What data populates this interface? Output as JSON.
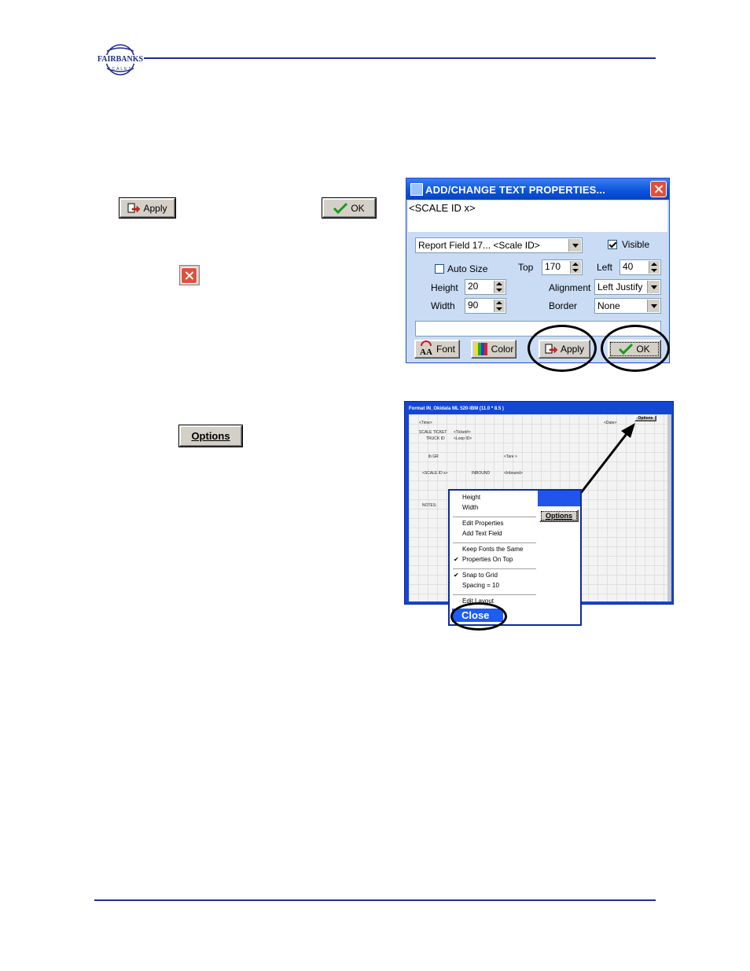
{
  "header": {
    "logo_text": "FAIRBANKS",
    "logo_sub": "SCALES"
  },
  "standalone": {
    "apply_label": "Apply",
    "ok_label": "OK",
    "options_label": "Options"
  },
  "dialog": {
    "title": "ADD/CHANGE TEXT PROPERTIES...",
    "text_value": "<SCALE ID  x>",
    "field_select": "Report Field 17... <Scale ID>",
    "visible_label": "Visible",
    "visible_checked": true,
    "auto_size_label": "Auto Size",
    "auto_size_checked": false,
    "top_label": "Top",
    "top_value": "170",
    "left_label": "Left",
    "left_value": "40",
    "height_label": "Height",
    "height_value": "20",
    "width_label": "Width",
    "width_value": "90",
    "alignment_label": "Alignment",
    "alignment_value": "Left Justify",
    "border_label": "Border",
    "border_value": "None",
    "font_label": "Font",
    "color_label": "Color",
    "apply_label": "Apply",
    "ok_label": "OK"
  },
  "format_window": {
    "title": "Format IN_Okidata ML 520-IBM (11.0 * 8.5 )",
    "options_label": "Options",
    "fields": {
      "time": "<Time>",
      "date": "<Date>",
      "scale_ticket": "SCALE TICKET",
      "ticket_val": "<Ticket#>",
      "truck_id": "TRUCK ID",
      "truck_val": "<Loop ID>",
      "gr": "lb GR",
      "tare": "<Tare >",
      "scale_id": "<SCALE ID  x>",
      "inbound": "INBOUND",
      "inbound_val": "<Inbound>",
      "notes": "NOTES:"
    }
  },
  "popup_menu": {
    "items": [
      "Height",
      "Width",
      "Edit Properties",
      "Add Text Field",
      "Keep Fonts the Same",
      "Properties On Top",
      "Snap to Grid",
      "Spacing = 10",
      "Edit Layout"
    ],
    "options_label": "Options",
    "close_label": "Close"
  }
}
